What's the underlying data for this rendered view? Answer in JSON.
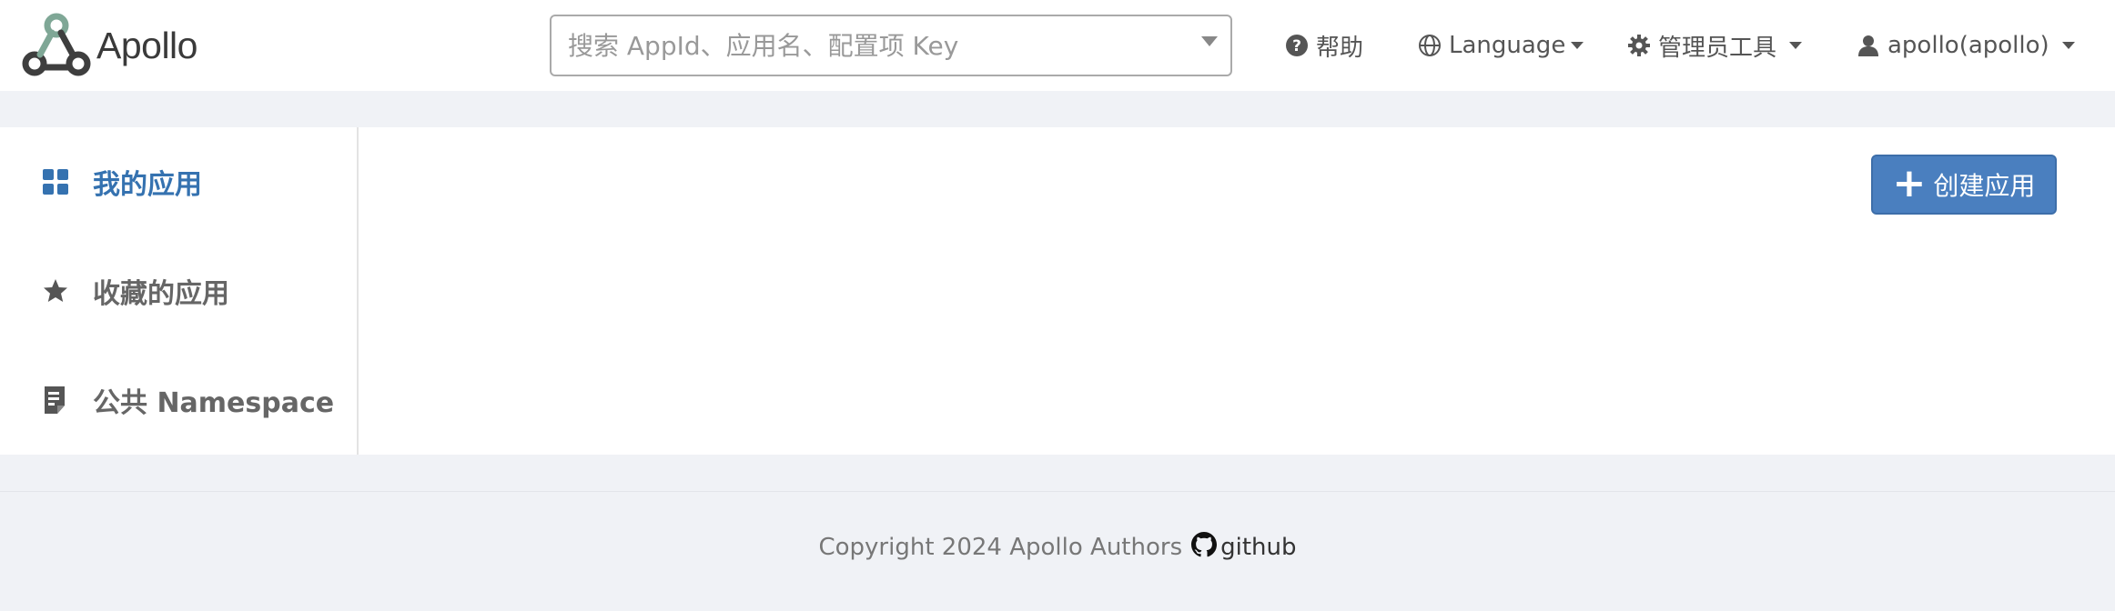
{
  "brand": {
    "name": "Apollo",
    "logo_icon": "apollo-logo-icon"
  },
  "search": {
    "placeholder": "搜索 AppId、应用名、配置项 Key",
    "value": ""
  },
  "nav": {
    "help": {
      "label": "帮助",
      "icon": "question-circle-icon"
    },
    "language": {
      "label": "Language",
      "icon": "globe-icon"
    },
    "admin_tools": {
      "label": "管理员工具",
      "icon": "gear-icon"
    },
    "user": {
      "label": "apollo(apollo)",
      "icon": "user-icon"
    }
  },
  "sidebar": {
    "items": [
      {
        "label": "我的应用",
        "icon": "grid-icon",
        "active": true
      },
      {
        "label": "收藏的应用",
        "icon": "star-icon",
        "active": false
      },
      {
        "label": "公共 Namespace",
        "icon": "document-icon",
        "active": false
      }
    ]
  },
  "main": {
    "create_button": "创建应用"
  },
  "footer": {
    "copyright": "Copyright 2024 Apollo Authors",
    "github": "github"
  },
  "colors": {
    "accent": "#3572b0",
    "button": "#4a7fbf",
    "background": "#f0f2f6"
  }
}
